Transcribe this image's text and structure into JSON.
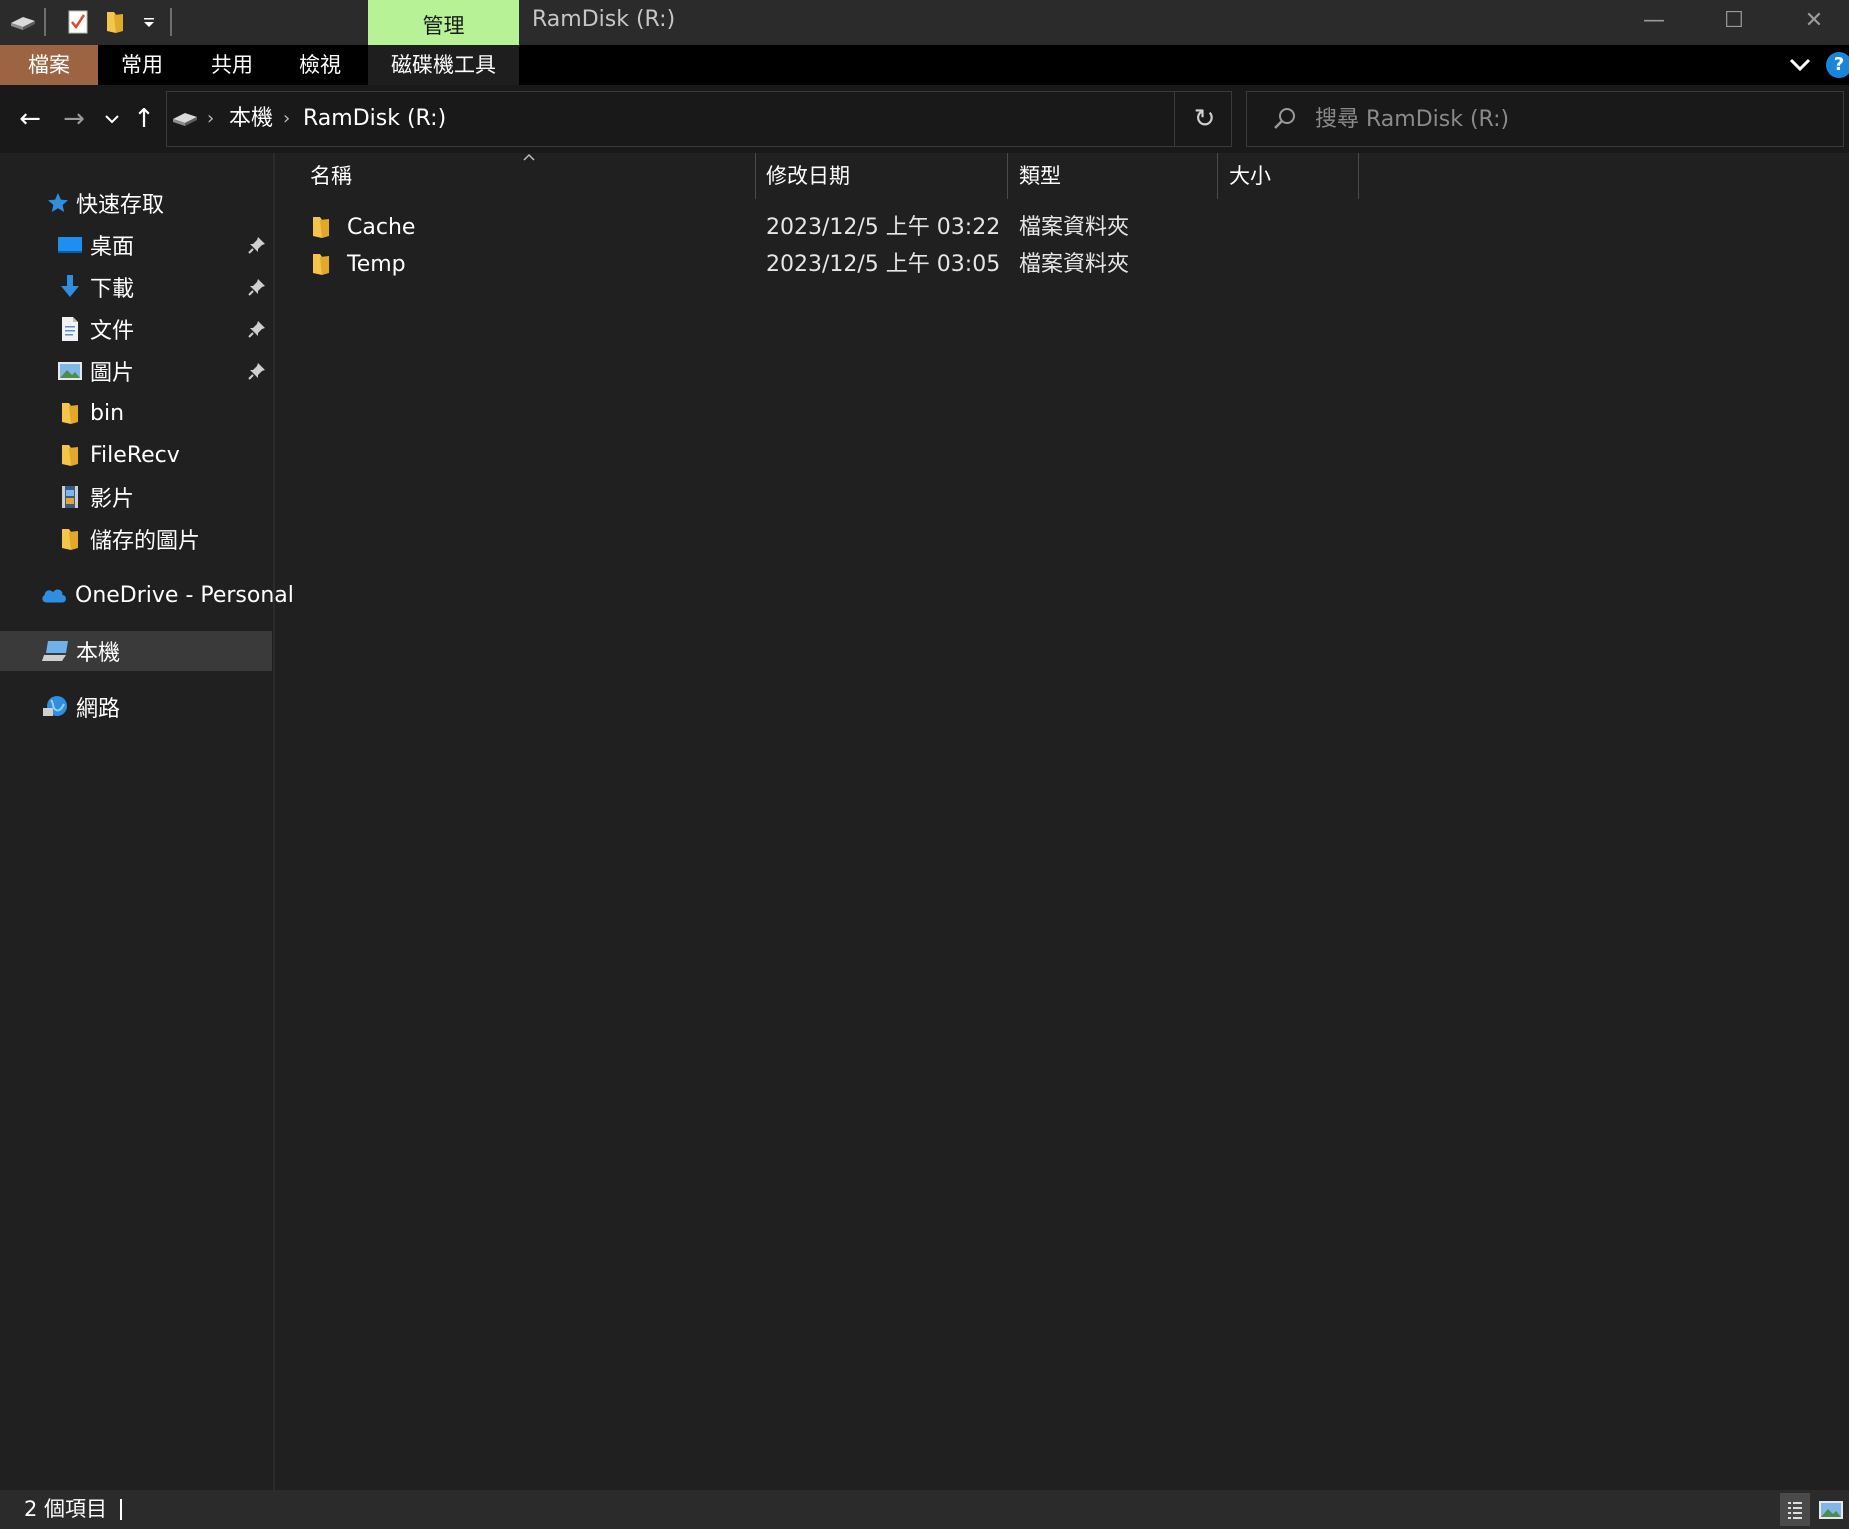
{
  "titlebar": {
    "context_tab": "管理",
    "window_title": "RamDisk (R:)",
    "minimize_glyph": "—",
    "maximize_glyph": "☐",
    "close_glyph": "✕"
  },
  "ribbon": {
    "tabs": [
      "檔案",
      "常用",
      "共用",
      "檢視",
      "磁碟機工具"
    ],
    "help_label": "?"
  },
  "navbar": {
    "back_glyph": "←",
    "forward_glyph": "→",
    "up_glyph": "↑",
    "breadcrumbs": [
      "本機",
      "RamDisk (R:)"
    ],
    "breadcrumb_sep": "›",
    "refresh_glyph": "↻",
    "search_placeholder": "搜尋 RamDisk (R:)"
  },
  "sidebar": {
    "quick_access": "快速存取",
    "items": [
      {
        "label": "桌面",
        "icon": "desktop-icon",
        "pinned": true
      },
      {
        "label": "下載",
        "icon": "download-icon",
        "pinned": true
      },
      {
        "label": "文件",
        "icon": "document-icon",
        "pinned": true
      },
      {
        "label": "圖片",
        "icon": "pictures-icon",
        "pinned": true
      },
      {
        "label": "bin",
        "icon": "folder-icon",
        "pinned": false
      },
      {
        "label": "FileRecv",
        "icon": "folder-icon",
        "pinned": false
      },
      {
        "label": "影片",
        "icon": "videos-icon",
        "pinned": false
      },
      {
        "label": "儲存的圖片",
        "icon": "folder-icon",
        "pinned": false
      }
    ],
    "onedrive": "OneDrive - Personal",
    "this_pc": "本機",
    "network": "網路"
  },
  "columns": {
    "name": "名稱",
    "date": "修改日期",
    "type": "類型",
    "size": "大小"
  },
  "files": [
    {
      "name": "Cache",
      "date": "2023/12/5 上午 03:22",
      "type": "檔案資料夾"
    },
    {
      "name": "Temp",
      "date": "2023/12/5 上午 03:05",
      "type": "檔案資料夾"
    }
  ],
  "status": {
    "item_count": "2 個項目"
  },
  "colors": {
    "accent_file_tab": "#9c6443",
    "context_tab": "#b7f296",
    "folder": "#f4c54a",
    "selection": "#3a3a3a"
  }
}
